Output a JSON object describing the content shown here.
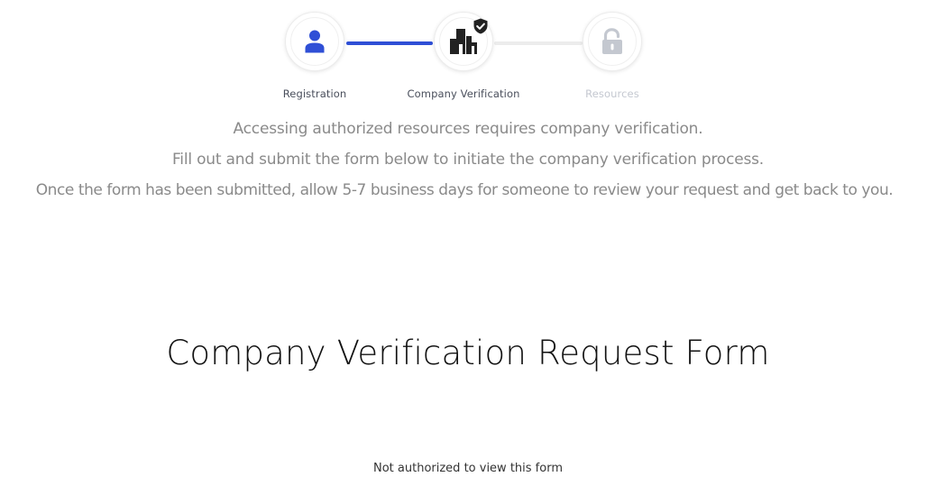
{
  "colors": {
    "accent": "#2f4fd6",
    "connector_inactive": "#ececec",
    "label_active": "#4a4f5c",
    "label_inactive": "#c4c8d0",
    "icon_dark": "#222222",
    "icon_disabled": "#c4c8d0"
  },
  "stepper": {
    "steps": [
      {
        "label": "Registration",
        "icon": "user-icon",
        "state": "complete"
      },
      {
        "label": "Company Verification",
        "icon": "buildings-icon",
        "state": "current",
        "badge_icon": "shield-check-icon"
      },
      {
        "label": "Resources",
        "icon": "unlocked-padlock-icon",
        "state": "disabled"
      }
    ]
  },
  "intro": {
    "line1": "Accessing authorized resources requires company verification.",
    "line2": "Fill out and submit the form below to initiate the company verification process.",
    "line3": "Once the form has been submitted, allow 5-7 business days for someone to review your request and get back to you."
  },
  "form": {
    "title": "Company Verification Request Form",
    "status_message": "Not authorized to view this form"
  }
}
